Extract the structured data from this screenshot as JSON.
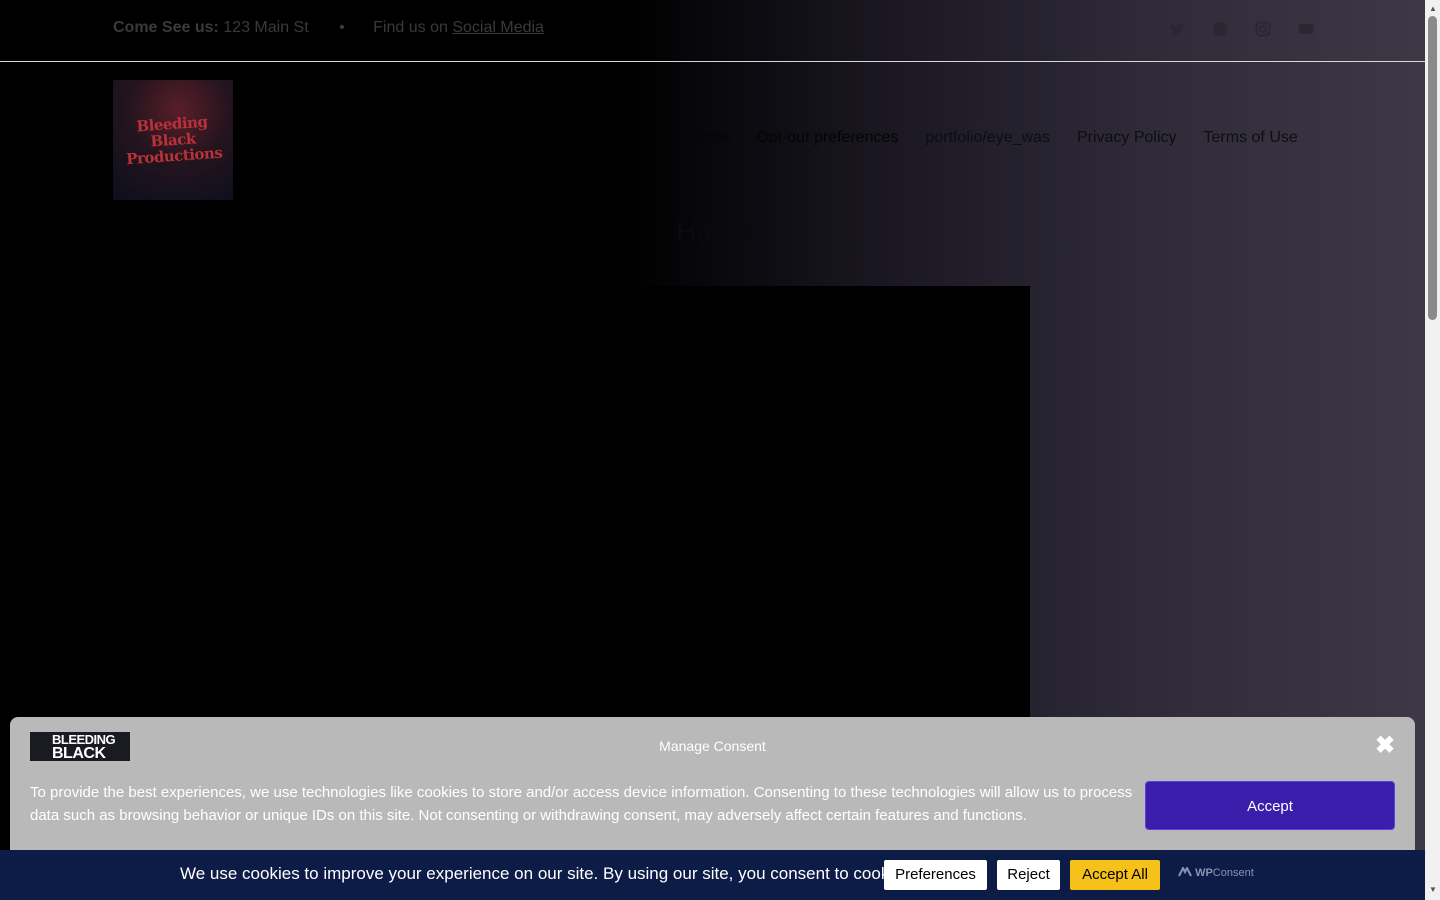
{
  "topbar": {
    "address_label": "Come See us:",
    "address_value": "123 Main St",
    "separator": "•",
    "social_prefix": "Find us on",
    "social_link": "Social Media",
    "social_icons": [
      "twitter-icon",
      "facebook-icon",
      "instagram-icon",
      "youtube-icon"
    ]
  },
  "header": {
    "logo_text": [
      "Bleeding",
      "Black",
      "Productions"
    ],
    "nav": [
      "Home",
      "Opt-out preferences",
      "portfolio/eye_was",
      "Privacy Policy",
      "Terms of Use"
    ]
  },
  "main": {
    "page_title": "Home"
  },
  "consent_modal": {
    "logo_line1": "BLEEDING",
    "logo_line2": "BLACK",
    "title": "Manage Consent",
    "close_glyph": "✖",
    "body": "To provide the best experiences, we use technologies like cookies to store and/or access device information. Consenting to these technologies will allow us to process data such as browsing behavior or unique IDs on this site. Not consenting or withdrawing consent, may adversely affect certain features and functions.",
    "accept_label": "Accept",
    "accent_color": "#3a1eab"
  },
  "cookie_bar": {
    "message": "We use cookies to improve your experience on our site. By using our site, you consent to cookies.",
    "preferences_label": "Preferences",
    "reject_label": "Reject",
    "accept_all_label": "Accept All",
    "brand_bold": "WP",
    "brand_rest": "Consent",
    "bar_color": "#0d1b47",
    "accept_color": "#f6c21a"
  }
}
